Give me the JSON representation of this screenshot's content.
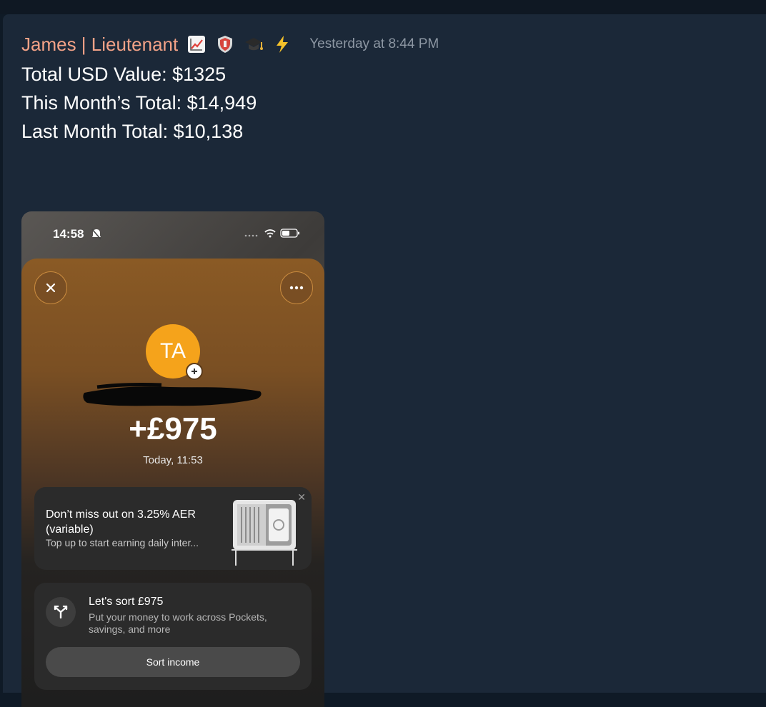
{
  "message": {
    "author": "James | Lieutenant",
    "badges": [
      "chart-increasing-icon",
      "shield-icon",
      "graduation-cap-icon",
      "lightning-icon"
    ],
    "timestamp": "Yesterday at 8:44 PM",
    "lines": [
      "Total USD Value: $1325",
      "This Month’s Total: $14,949",
      "Last Month Total: $10,138"
    ]
  },
  "attachment": {
    "status_time": "14:58",
    "avatar_initials": "TA",
    "amount": "+£975",
    "date": "Today, 11:53",
    "promo": {
      "title": "Don’t miss out on 3.25% AER (variable)",
      "subtitle": "Top up to start earning daily inter..."
    },
    "sort": {
      "title": "Let's sort £975",
      "subtitle": "Put your money to work across Pockets, savings, and more",
      "button_label": "Sort income"
    }
  },
  "colors": {
    "background": "#1b2838",
    "author": "#f3a287",
    "timestamp": "#8d97a3",
    "avatar": "#f5a31b"
  }
}
